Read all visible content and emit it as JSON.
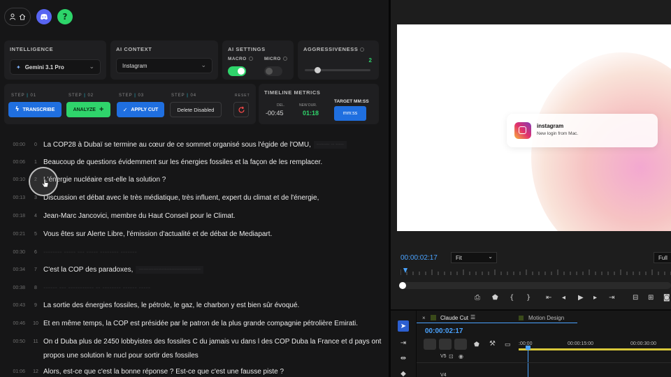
{
  "top": {
    "icons": [
      "person-icon",
      "home-icon",
      "discord-icon",
      "help-icon"
    ],
    "help_label": "?"
  },
  "intelligence": {
    "title": "INTELLIGENCE",
    "model": "Gemini 3.1 Pro"
  },
  "ai_context": {
    "title": "AI CONTEXT",
    "value": "Instagram"
  },
  "ai_settings": {
    "title": "AI SETTINGS",
    "macro_label": "MACRO",
    "micro_label": "MICRO",
    "macro_on": true,
    "micro_on": false
  },
  "aggressiveness": {
    "title": "AGGRESSIVENESS",
    "value": "2",
    "level": 0.2
  },
  "steps": [
    {
      "label": "STEP",
      "num": "01",
      "button": "TRANSCRIBE",
      "color": "#1f6fe0"
    },
    {
      "label": "STEP",
      "num": "02",
      "button": "ANALYZE",
      "color": "#2fd46b"
    },
    {
      "label": "STEP",
      "num": "03",
      "button": "APPLY CUT",
      "color": "#1f6fe0"
    },
    {
      "label": "STEP",
      "num": "04",
      "button": "Delete Disabled",
      "color": "#202022"
    }
  ],
  "reset_label": "RESET",
  "metrics": {
    "title": "TIMELINE METRICS",
    "del_label": "DEL.",
    "del_value": "-00:45",
    "newdur_label": "NEW DUR.",
    "newdur_value": "01:18",
    "target_label": "TARGET MM:SS",
    "target_placeholder": "mm:ss"
  },
  "transcript": [
    {
      "ts": "00:00",
      "idx": "0",
      "text": "La COP28 à Dubaï se termine au cœur de ce sommet organisé sous l'égide de l'OMU,",
      "ghost": "-------- -- -----",
      "dim": false
    },
    {
      "ts": "00:06",
      "idx": "1",
      "text": "Beaucoup de questions évidemment sur les énergies fossiles et la façon de les remplacer.",
      "ghost": "",
      "dim": false
    },
    {
      "ts": "00:10",
      "idx": "2",
      "text": "L'énergie nucléaire est-elle la solution ?",
      "ghost": "",
      "dim": false
    },
    {
      "ts": "00:13",
      "idx": "3",
      "text": "Discussion et débat avec le très médiatique, très influent, expert du climat et de l'énergie,",
      "ghost": "",
      "dim": false
    },
    {
      "ts": "00:18",
      "idx": "4",
      "text": "Jean-Marc Jancovici, membre du Haut Conseil pour le Climat.",
      "ghost": "",
      "dim": false
    },
    {
      "ts": "00:21",
      "idx": "5",
      "text": "Vous êtes sur Alerte Libre, l'émission d'actualité et de débat de Mediapart.",
      "ghost": "",
      "dim": false
    },
    {
      "ts": "00:30",
      "idx": "6",
      "text": "-------- ----- --- ----- -------- -------",
      "ghost": "",
      "dim": true
    },
    {
      "ts": "00:34",
      "idx": "7",
      "text": "C'est la COP des paradoxes,",
      "ghost": "--------------------------------------",
      "dim": false
    },
    {
      "ts": "00:38",
      "idx": "8",
      "text": "------ --- ----------- -- -------- ------ -----",
      "ghost": "",
      "dim": true
    },
    {
      "ts": "00:43",
      "idx": "9",
      "text": "La sortie des énergies fossiles, le pétrole, le gaz, le charbon y est bien sûr évoqué.",
      "ghost": "",
      "dim": false
    },
    {
      "ts": "00:46",
      "idx": "10",
      "text": "Et en même temps, la COP est présidée par le patron de la plus grande compagnie pétrolière Emirati.",
      "ghost": "",
      "dim": false
    },
    {
      "ts": "00:50",
      "idx": "11",
      "text": "On d Duba plus de 2450 lobbyistes des fossiles C du jamais vu dans l des COP Duba la France et d pays ont",
      "text2": "propos une solution le nucl pour sortir des fossiles",
      "ghost": "",
      "dim": false
    },
    {
      "ts": "01:06",
      "idx": "12",
      "text": "Alors, est-ce que c'est la bonne réponse ? Est-ce que c'est une fausse piste ?",
      "ghost": "",
      "dim": false
    }
  ],
  "preview": {
    "notif_app": "instagram",
    "notif_text": "New login from Mac."
  },
  "monitor": {
    "timecode": "00:00:02:17",
    "fit": "Fit",
    "full": "Full"
  },
  "sequence": {
    "tab1": "Claude Cut",
    "tab2": "Motion Design",
    "timecode": "00:00:02:17",
    "ruler": [
      ":00:00",
      "00:00:15:00",
      "00:00:30:00"
    ],
    "tracks": [
      "V5",
      "V4"
    ]
  }
}
